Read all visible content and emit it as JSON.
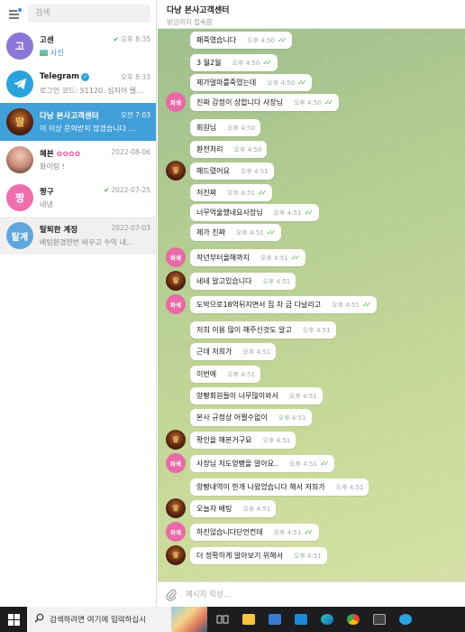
{
  "search": {
    "placeholder": "검색"
  },
  "chats": [
    {
      "avatar_text": "고",
      "avatar_color": "#8c77d6",
      "name": "고센",
      "time": "오후 8:35",
      "preview": "사진",
      "read": true
    },
    {
      "avatar_text": "",
      "avatar_color": "#2aa3dd",
      "name": "Telegram",
      "time": "오후 8:33",
      "preview": "로그인 코드: 51120. 심지어 텔...",
      "verified": true
    },
    {
      "avatar_text": "",
      "avatar_color": "#3b1a0d",
      "name": "다낭 본사고객센터",
      "time": "오전 7:03",
      "preview": "이 이상 문의받지 않겠습니다 ...",
      "active": true
    },
    {
      "avatar_text": "",
      "avatar_color": "#c98c7a",
      "name": "혜븐",
      "time": "2022-08-06",
      "preview": "화이팅 !"
    },
    {
      "avatar_text": "짱",
      "avatar_color": "#ef6fae",
      "name": "짱구",
      "time": "2022-07-25",
      "preview": "네넹",
      "read": true
    },
    {
      "avatar_text": "탈계",
      "avatar_color": "#5fa7dd",
      "name": "탈퇴한 계정",
      "time": "2022-07-03",
      "preview": "배팅환경한번 바꾸고 수익 내...",
      "gray": true
    }
  ],
  "conversation": {
    "title": "다낭 본사고객센터",
    "status": "방금까지 접속함"
  },
  "sender_avatars": {
    "pink_label": "파색",
    "dark_label": "딸"
  },
  "messages": [
    {
      "text": "패죽였습니다",
      "time": "오후 4:50",
      "read": true
    },
    {
      "text": "3 월2월",
      "time": "오후 4:50",
      "read": true
    },
    {
      "text": "제가얼마를죽였는데",
      "time": "오후 4:50",
      "read": true
    },
    {
      "text": "진짜 감정이 상합니다 사장님",
      "time": "오후 4:50",
      "read": true,
      "avatar": "pink"
    },
    {
      "text": "회원님",
      "time": "오후 4:50",
      "read": false
    },
    {
      "text": "환전처리",
      "time": "오후 4:50",
      "read": false
    },
    {
      "text": "해드렸어요",
      "time": "오후 4:51",
      "read": false,
      "avatar": "dark"
    },
    {
      "text": "저진짜",
      "time": "오후 4:51",
      "read": true
    },
    {
      "text": "너무억울했네요사장님",
      "time": "오후 4:51",
      "read": true
    },
    {
      "text": "제가 진짜",
      "time": "오후 4:51",
      "read": true
    },
    {
      "text": "작년부터올해까지",
      "time": "오후 4:51",
      "read": true,
      "avatar": "pink"
    },
    {
      "text": "네네 알고있습니다",
      "time": "오후 4:51",
      "read": false,
      "avatar": "dark"
    },
    {
      "text": "도박으로18억뒤지면서 집 차 금 다날리고",
      "time": "오후 4:51",
      "read": true,
      "avatar": "pink"
    },
    {
      "text": "저희 이용 많이 해주신것도 알고",
      "time": "오후 4:51",
      "read": false
    },
    {
      "text": "근데 저희가",
      "time": "오후 4:51",
      "read": false
    },
    {
      "text": "이번에",
      "time": "오후 4:51",
      "read": false
    },
    {
      "text": "양빵회원들이 너무많이와서",
      "time": "오후 4:51",
      "read": false
    },
    {
      "text": "본사 규정상 어쩔수없이",
      "time": "오후 4:51",
      "read": false
    },
    {
      "text": "확인을 해본거구요",
      "time": "오후 4:51",
      "read": false,
      "avatar": "dark"
    },
    {
      "text": "사장님 저도양빵을 알아요..",
      "time": "오후 4:51",
      "read": true,
      "avatar": "pink"
    },
    {
      "text": "양빵내역이 한개 나왔었습니다 해서 저희가",
      "time": "오후 4:51",
      "read": false
    },
    {
      "text": "오늘자 배팅",
      "time": "오후 4:51",
      "read": false,
      "avatar": "dark"
    },
    {
      "text": "하진않습니다단언컨데",
      "time": "오후 4:51",
      "read": true,
      "avatar": "pink"
    },
    {
      "text": "더 정확하게 알아보기 위해서",
      "time": "오후 4:51",
      "read": false,
      "avatar": "dark"
    }
  ],
  "composer": {
    "placeholder": "메시지 작성..."
  },
  "taskbar": {
    "search_text": "검색하려면 여기에 입력하십시"
  },
  "colors": {
    "accent": "#419fd9",
    "read_check": "#4fae4e",
    "taskbar": "#1d1d1f"
  }
}
